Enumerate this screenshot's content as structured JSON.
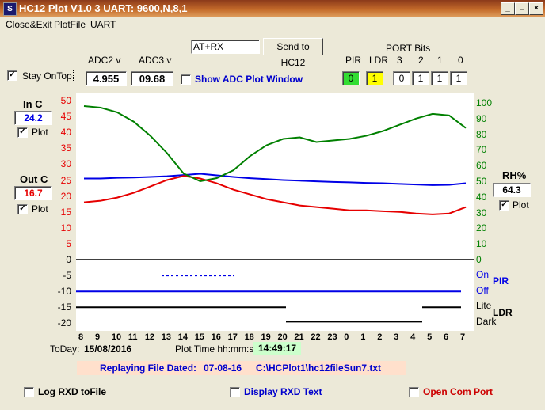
{
  "window": {
    "title": "HC12 Plot V1.0 3 UART: 9600,N,8,1",
    "icon": "S",
    "min": "_",
    "max": "□",
    "close": "×"
  },
  "menu": [
    "Close&Exit",
    "PlotFile",
    "UART"
  ],
  "command": {
    "value": "AT+RX",
    "send_label": "Send to HC12"
  },
  "stay_on_top": {
    "label": "Stay OnTop",
    "checked": true
  },
  "adc": {
    "adc2_label": "ADC2 v",
    "adc3_label": "ADC3 v",
    "adc2_value": "4.955",
    "adc3_value": "09.68",
    "show_label": "Show ADC Plot Window"
  },
  "port": {
    "title": "PORT Bits",
    "labels": [
      "PIR",
      "LDR",
      "3",
      "2",
      "1",
      "0"
    ],
    "values": [
      "0",
      "1",
      "0",
      "1",
      "1",
      "1"
    ]
  },
  "in_c": {
    "title": "In C",
    "value": "24.2",
    "plot_label": "Plot"
  },
  "out_c": {
    "title": "Out C",
    "value": "16.7",
    "plot_label": "Plot"
  },
  "rh": {
    "title": "RH%",
    "value": "64.3",
    "plot_label": "Plot"
  },
  "axes": {
    "left_temp": [
      "50",
      "45",
      "40",
      "35",
      "30",
      "25",
      "20",
      "15",
      "10",
      "5"
    ],
    "left_lower": [
      "0",
      "-5",
      "-10",
      "-15",
      "-20"
    ],
    "right_rh": [
      "100",
      "90",
      "80",
      "70",
      "60",
      "50",
      "40",
      "30",
      "20",
      "10",
      "0"
    ],
    "right_on": "On",
    "right_off": "Off",
    "right_pir": "PIR",
    "right_lite": "Lite",
    "right_dark": "Dark",
    "right_ldr": "LDR",
    "hours": [
      "8",
      "9",
      "10",
      "11",
      "12",
      "13",
      "14",
      "15",
      "16",
      "17",
      "18",
      "19",
      "20",
      "21",
      "22",
      "23",
      "0",
      "1",
      "2",
      "3",
      "4",
      "5",
      "6",
      "7"
    ]
  },
  "footer": {
    "today_label": "ToDay:",
    "today_value": "15/08/2016",
    "plot_time_label": "Plot  Time hh:mm:ss",
    "plot_time_value": "14:49:17",
    "replay_label": "Replaying File Dated:",
    "replay_date": "07-08-16",
    "replay_path": "C:\\HCPlot1\\hc12fileSun7.txt"
  },
  "options": {
    "log_rxd": "Log RXD toFile",
    "display_rxd": "Display RXD Text",
    "open_com": "Open Com Port"
  },
  "chart_data": {
    "type": "line",
    "x": [
      "8",
      "9",
      "10",
      "11",
      "12",
      "13",
      "14",
      "15",
      "16",
      "17",
      "18",
      "19",
      "20",
      "21",
      "22",
      "23",
      "0",
      "1",
      "2",
      "3",
      "4",
      "5",
      "6",
      "7"
    ],
    "series": [
      {
        "name": "In C",
        "color": "#0000e6",
        "values": [
          25.5,
          25.5,
          25.7,
          25.8,
          26.0,
          26.2,
          26.6,
          27,
          26.5,
          26.0,
          25.6,
          25.3,
          25.0,
          24.8,
          24.6,
          24.4,
          24.3,
          24.1,
          24.0,
          23.8,
          23.6,
          23.4,
          23.5,
          24.0
        ]
      },
      {
        "name": "Out C",
        "color": "#e60000",
        "values": [
          18,
          18.5,
          19.5,
          21,
          23,
          25,
          26.3,
          25.5,
          24,
          22,
          20.5,
          19,
          18,
          17,
          16.5,
          16,
          15.5,
          15.5,
          15.2,
          15,
          14.5,
          14.2,
          14.5,
          16.5
        ]
      },
      {
        "name": "RH%",
        "color": "#008000",
        "values": [
          98,
          97,
          94,
          88,
          79,
          68,
          55,
          50,
          52,
          57,
          66,
          73,
          77,
          78,
          75,
          76,
          77,
          79,
          82,
          86,
          90,
          93,
          92,
          84
        ]
      }
    ],
    "ylim": [
      -20,
      50
    ],
    "y2lim": [
      0,
      100
    ]
  }
}
